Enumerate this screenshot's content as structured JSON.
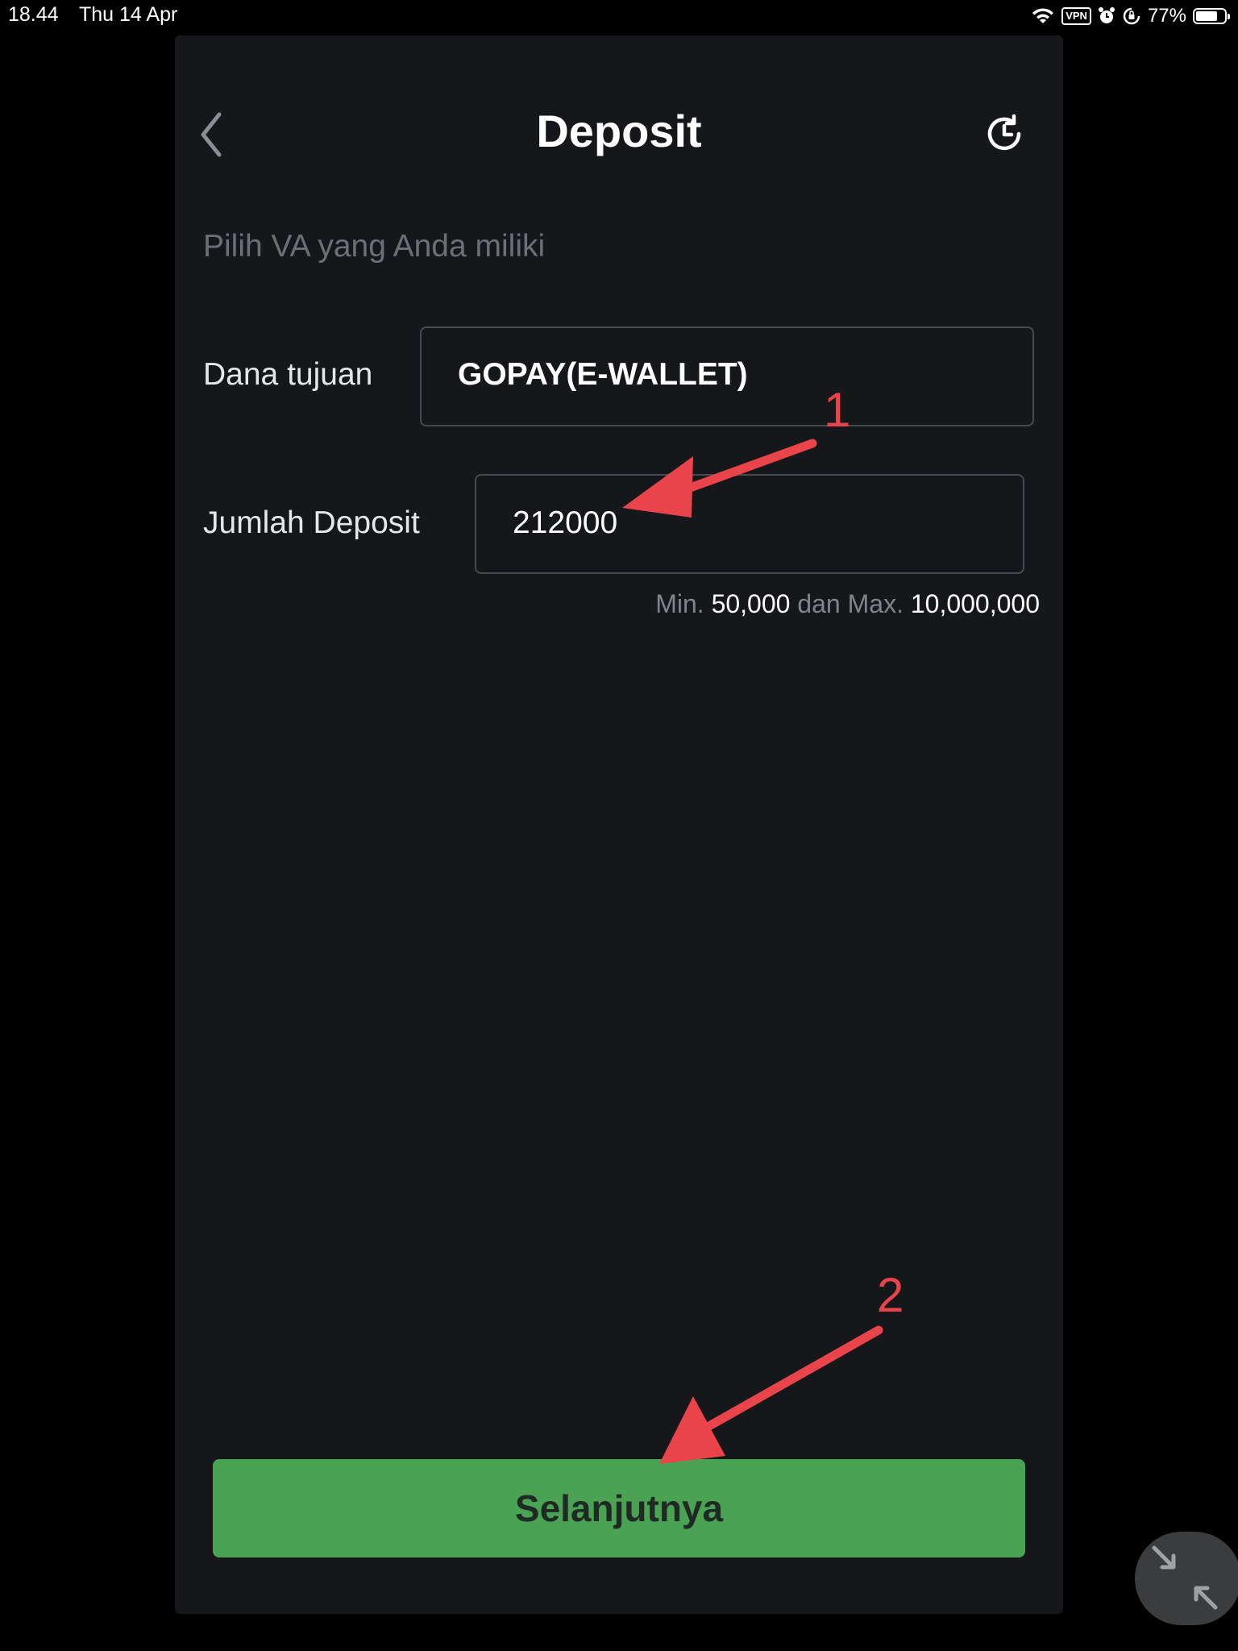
{
  "status_bar": {
    "time": "18.44",
    "date": "Thu 14 Apr",
    "vpn": "VPN",
    "battery": "77%",
    "battery_level": 0.77
  },
  "header": {
    "title": "Deposit",
    "back_icon": "chevron-left-icon",
    "history_icon": "history-clock-icon"
  },
  "form": {
    "subtitle": "Pilih VA yang Anda miliki",
    "destination_label": "Dana tujuan",
    "destination_value": "GOPAY(E-WALLET)",
    "amount_label": "Jumlah Deposit",
    "amount_value": "212000",
    "hint_min_prefix": "Min.",
    "hint_min_value": "50,000",
    "hint_mid": "dan Max.",
    "hint_max_value": "10,000,000"
  },
  "actions": {
    "next_label": "Selanjutnya"
  },
  "annotations": {
    "marker_1": "1",
    "marker_2": "2",
    "color": "#e8444a"
  },
  "colors": {
    "panel_bg": "#16171b",
    "accent_green": "#4aa353",
    "field_border": "#484b52"
  }
}
